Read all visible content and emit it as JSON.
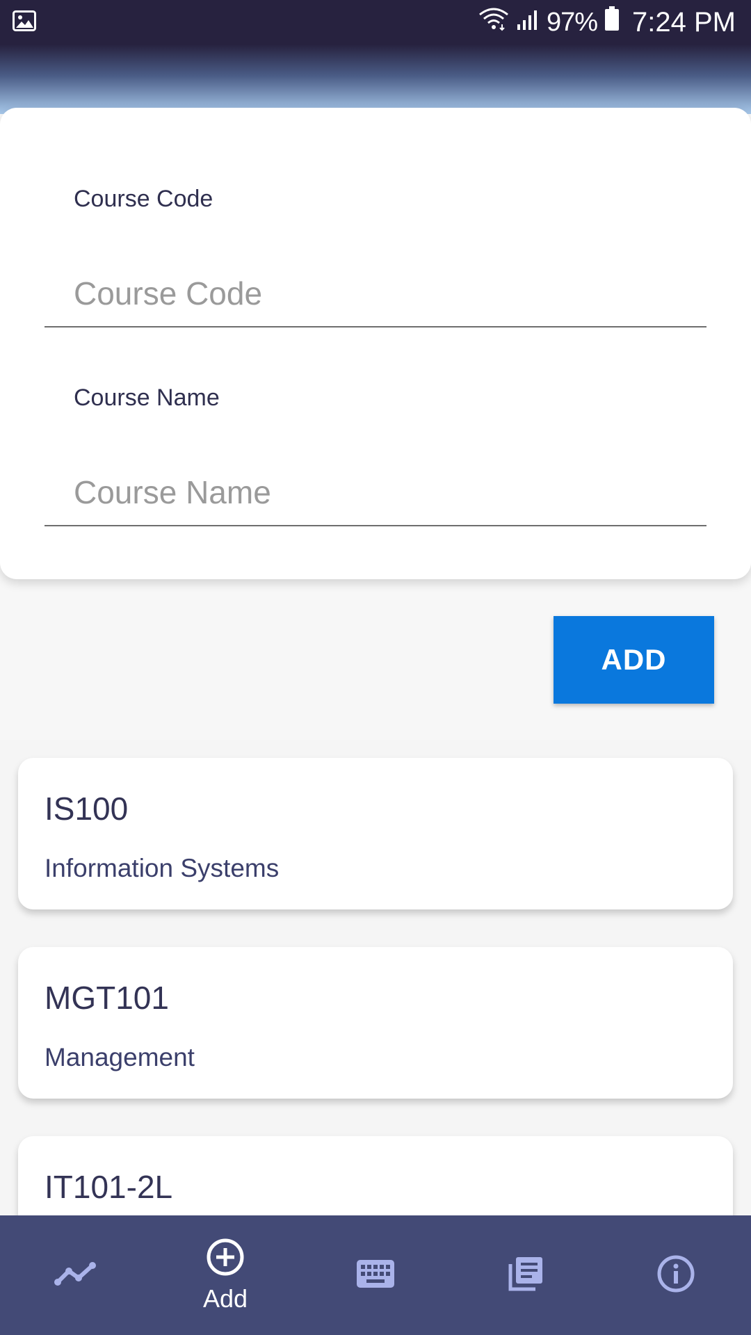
{
  "status_bar": {
    "battery_percent": "97%",
    "time": "7:24 PM",
    "icons": [
      "image-notification-icon",
      "wifi-icon",
      "signal-icon",
      "battery-icon"
    ]
  },
  "form": {
    "course_code_label": "Course Code",
    "course_code_placeholder": "Course Code",
    "course_code_value": "",
    "course_name_label": "Course Name",
    "course_name_placeholder": "Course Name",
    "course_name_value": ""
  },
  "add_button_label": "ADD",
  "courses": [
    {
      "code": "IS100",
      "name": "Information Systems"
    },
    {
      "code": "MGT101",
      "name": "Management"
    },
    {
      "code": "IT101-2L",
      "name": ""
    }
  ],
  "bottom_nav": {
    "items": [
      {
        "icon": "chart-line-icon",
        "label": ""
      },
      {
        "icon": "add-circle-icon",
        "label": "Add"
      },
      {
        "icon": "keyboard-icon",
        "label": ""
      },
      {
        "icon": "library-books-icon",
        "label": ""
      },
      {
        "icon": "info-icon",
        "label": ""
      }
    ],
    "active_index": 1
  },
  "colors": {
    "status_bar": "#27223f",
    "accent_button": "#0a78dd",
    "bottom_nav": "#434a76",
    "nav_icon_inactive": "#aab3ea",
    "text_primary": "#333355"
  }
}
